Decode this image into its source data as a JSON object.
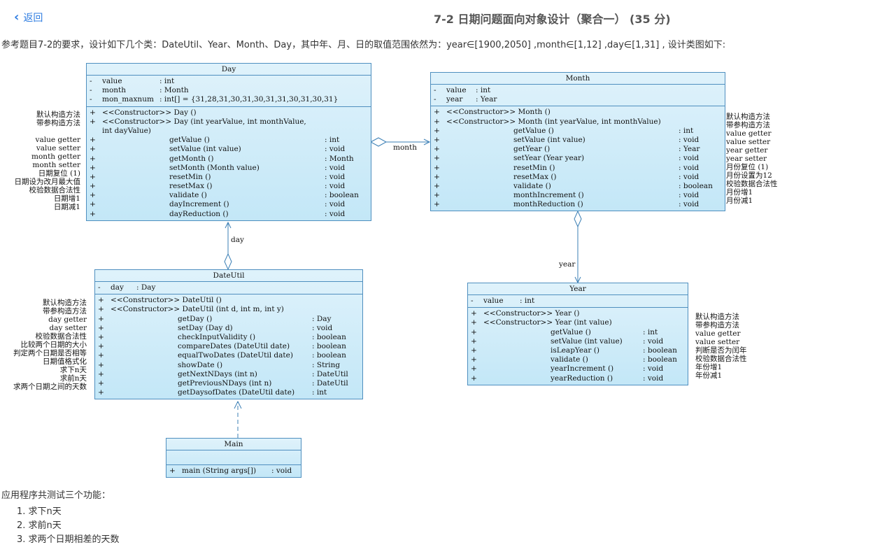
{
  "header": {
    "back_label": "返回",
    "title": "7-2 日期问题面向对象设计（聚合一） (35 分)"
  },
  "description": "参考题目7-2的要求，设计如下几个类：DateUtil、Year、Month、Day，其中年、月、日的取值范围依然为：year∈[1900,2050] ,month∈[1,12] ,day∈[1,31] , 设计类图如下:",
  "classes": {
    "day": {
      "name": "Day",
      "attrs": [
        [
          "-",
          "value",
          ": int"
        ],
        [
          "-",
          "month",
          ": Month"
        ],
        [
          "-",
          "mon_maxnum",
          ": int[]   = {31,28,31,30,31,30,31,31,30,31,30,31}"
        ]
      ],
      "ops": [
        [
          "+",
          "<<Constructor>>  Day ()",
          ""
        ],
        [
          "+",
          "<<Constructor>>  Day (int yearValue, int monthValue,",
          ""
        ],
        [
          "",
          "                   int dayValue)",
          ""
        ],
        [
          "+",
          "getValue ()",
          ": int"
        ],
        [
          "+",
          "setValue (int value)",
          ": void"
        ],
        [
          "+",
          "getMonth ()",
          ": Month"
        ],
        [
          "+",
          "setMonth (Month value)",
          ": void"
        ],
        [
          "+",
          "resetMin ()",
          ": void"
        ],
        [
          "+",
          "resetMax ()",
          ": void"
        ],
        [
          "+",
          "validate ()",
          ": boolean"
        ],
        [
          "+",
          "dayIncrement ()",
          ": void"
        ],
        [
          "+",
          "dayReduction ()",
          ": void"
        ]
      ],
      "notes": [
        "默认构造方法",
        "带参构造方法",
        "",
        "value getter",
        "value setter",
        "month getter",
        "month setter",
        "日期复位 (1)",
        "日期设为改月最大值",
        "校验数据合法性",
        "日期增1",
        "日期减1"
      ]
    },
    "month": {
      "name": "Month",
      "attrs": [
        [
          "-",
          "value",
          ": int"
        ],
        [
          "-",
          "year",
          ": Year"
        ]
      ],
      "ops": [
        [
          "+",
          "<<Constructor>>  Month ()",
          ""
        ],
        [
          "+",
          "<<Constructor>>  Month (int yearValue, int monthValue)",
          ""
        ],
        [
          "+",
          "getValue ()",
          ": int"
        ],
        [
          "+",
          "setValue (int value)",
          ": void"
        ],
        [
          "+",
          "getYear ()",
          ": Year"
        ],
        [
          "+",
          "setYear (Year year)",
          ": void"
        ],
        [
          "+",
          "resetMin ()",
          ": void"
        ],
        [
          "+",
          "resetMax ()",
          ": void"
        ],
        [
          "+",
          "validate ()",
          ": boolean"
        ],
        [
          "+",
          "monthIncrement ()",
          ": void"
        ],
        [
          "+",
          "monthReduction ()",
          ": void"
        ]
      ],
      "notes": [
        "默认构造方法",
        "带参构造方法",
        "value getter",
        "value setter",
        "year getter",
        "year setter",
        "月份复位 (1)",
        "月份设置为12",
        "校验数据合法性",
        "月份增1",
        "月份减1"
      ]
    },
    "year": {
      "name": "Year",
      "attrs": [
        [
          "-",
          "value",
          ": int"
        ]
      ],
      "ops": [
        [
          "+",
          "<<Constructor>>  Year ()",
          ""
        ],
        [
          "+",
          "<<Constructor>>  Year (int value)",
          ""
        ],
        [
          "+",
          "getValue ()",
          ": int"
        ],
        [
          "+",
          "setValue (int value)",
          ": void"
        ],
        [
          "+",
          "isLeapYear ()",
          ": boolean"
        ],
        [
          "+",
          "validate ()",
          ": boolean"
        ],
        [
          "+",
          "yearIncrement ()",
          ": void"
        ],
        [
          "+",
          "yearReduction ()",
          ": void"
        ]
      ],
      "notes": [
        "默认构造方法",
        "带参构造方法",
        "value getter",
        "value setter",
        "判断是否为闰年",
        "校验数据合法性",
        "年份增1",
        "年份减1"
      ]
    },
    "dateutil": {
      "name": "DateUtil",
      "attrs": [
        [
          "-",
          "day",
          ": Day"
        ]
      ],
      "ops": [
        [
          "+",
          "<<Constructor>>  DateUtil ()",
          ""
        ],
        [
          "+",
          "<<Constructor>>  DateUtil (int d, int m, int y)",
          ""
        ],
        [
          "+",
          "getDay ()",
          ": Day"
        ],
        [
          "+",
          "setDay (Day d)",
          ": void"
        ],
        [
          "+",
          "checkInputValidity ()",
          ": boolean"
        ],
        [
          "+",
          "compareDates (DateUtil date)",
          ": boolean"
        ],
        [
          "+",
          "equalTwoDates (DateUtil date)",
          ": boolean"
        ],
        [
          "+",
          "showDate ()",
          ": String"
        ],
        [
          "+",
          "getNextNDays (int n)",
          ": DateUtil"
        ],
        [
          "+",
          "getPreviousNDays (int n)",
          ": DateUtil"
        ],
        [
          "+",
          "getDaysofDates (DateUtil date)",
          ": int"
        ]
      ],
      "notes": [
        "默认构造方法",
        "带参构造方法",
        "day getter",
        "day setter",
        "校验数据合法性",
        "比较两个日期的大小",
        "判定两个日期是否相等",
        "日期值格式化",
        "求下n天",
        "求前n天",
        "求两个日期之间的天数"
      ]
    },
    "main": {
      "name": "Main",
      "attrs": [],
      "ops": [
        [
          "+",
          "main (String args[])",
          ": void"
        ]
      ]
    }
  },
  "edges": {
    "day_month": "month",
    "dateutil_day": "day",
    "month_year": "year"
  },
  "footer": {
    "note": "应用程序共测试三个功能：",
    "items": [
      "1. 求下n天",
      "2. 求前n天",
      "3. 求两个日期相差的天数"
    ]
  }
}
